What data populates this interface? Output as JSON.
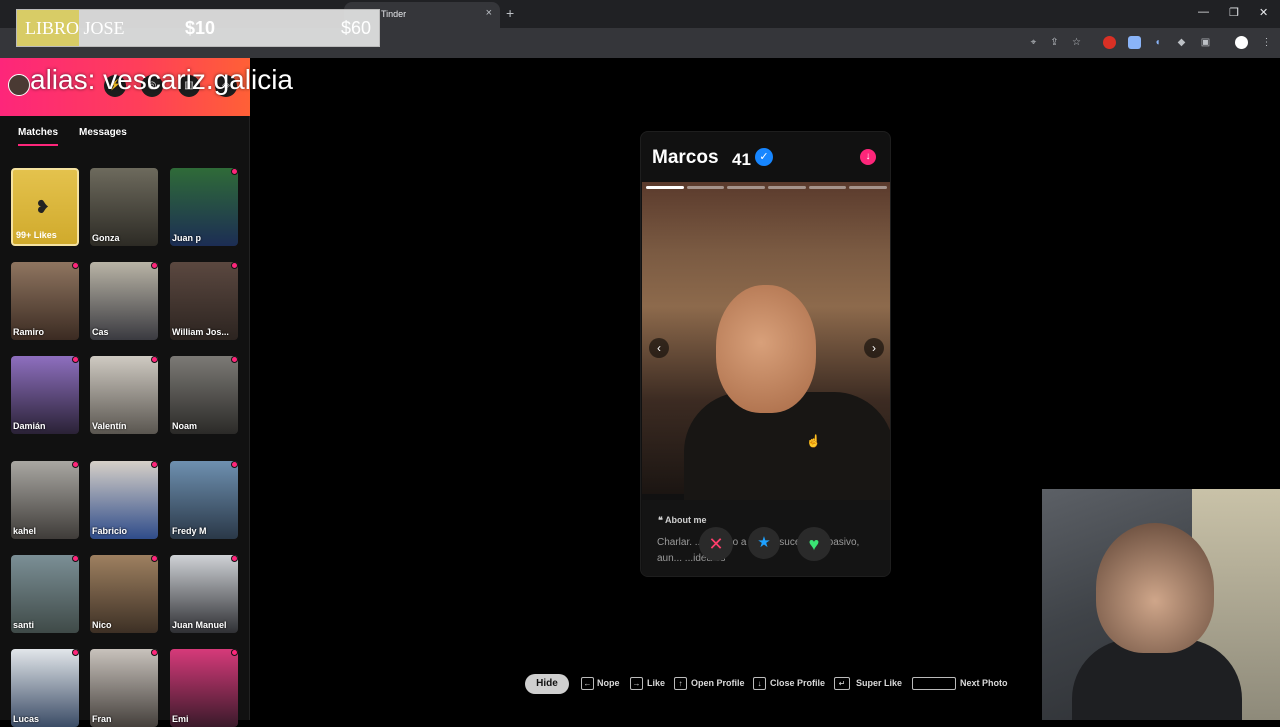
{
  "browser": {
    "tab_title": "Tinder",
    "tab_close": "×",
    "new_tab": "+",
    "minimize": "—",
    "restore": "❐",
    "close": "✕"
  },
  "overlay": {
    "donation_name": "LIBRO JOSE",
    "donation_current": "$10",
    "donation_goal": "$60",
    "donation_progress": 0.17,
    "alias": "alias: vescariz.galicia"
  },
  "sidebar": {
    "tabs": [
      {
        "label": "Matches",
        "active": true
      },
      {
        "label": "Messages",
        "active": false
      }
    ],
    "likes_label": "99+ Likes",
    "matches": [
      {
        "name": "Gonza",
        "unread": false
      },
      {
        "name": "Juan p",
        "unread": true
      },
      {
        "name": "Ramiro",
        "unread": true
      },
      {
        "name": "Cas",
        "unread": true
      },
      {
        "name": "William Jos...",
        "unread": true
      },
      {
        "name": "Damián",
        "unread": true
      },
      {
        "name": "Valentín",
        "unread": true
      },
      {
        "name": "Noam",
        "unread": true
      },
      {
        "name": "kahel",
        "unread": true
      },
      {
        "name": "Fabricio",
        "unread": true
      },
      {
        "name": "Fredy M",
        "unread": true
      },
      {
        "name": "santi",
        "unread": true
      },
      {
        "name": "Nico",
        "unread": true
      },
      {
        "name": "Juan Manuel",
        "unread": true
      },
      {
        "name": "Lucas",
        "unread": true
      },
      {
        "name": "Fran",
        "unread": true
      },
      {
        "name": "Emi",
        "unread": true
      }
    ]
  },
  "profile": {
    "name": "Marcos",
    "age": "41",
    "verified": true,
    "photo_count": 6,
    "current_photo": 1,
    "about_title": "About me",
    "about_text": "Charlar. ... D... ...o a lo que suce... ...s pasivo, aun... ...idea es"
  },
  "actions": {
    "nope_icon": "✕",
    "superlike_icon": "★",
    "like_icon": "♥"
  },
  "hints": {
    "hide": "Hide",
    "nope": "Nope",
    "like": "Like",
    "open_profile": "Open Profile",
    "close_profile": "Close Profile",
    "super_like": "Super Like",
    "next_photo": "Next Photo"
  },
  "colors": {
    "brand_pink": "#fd267a",
    "brand_orange": "#ff6036",
    "likes_gold": "#e4c24d",
    "nope_red": "#ff3e6c",
    "superlike_blue": "#1ea1ff",
    "like_green": "#3ae374"
  }
}
